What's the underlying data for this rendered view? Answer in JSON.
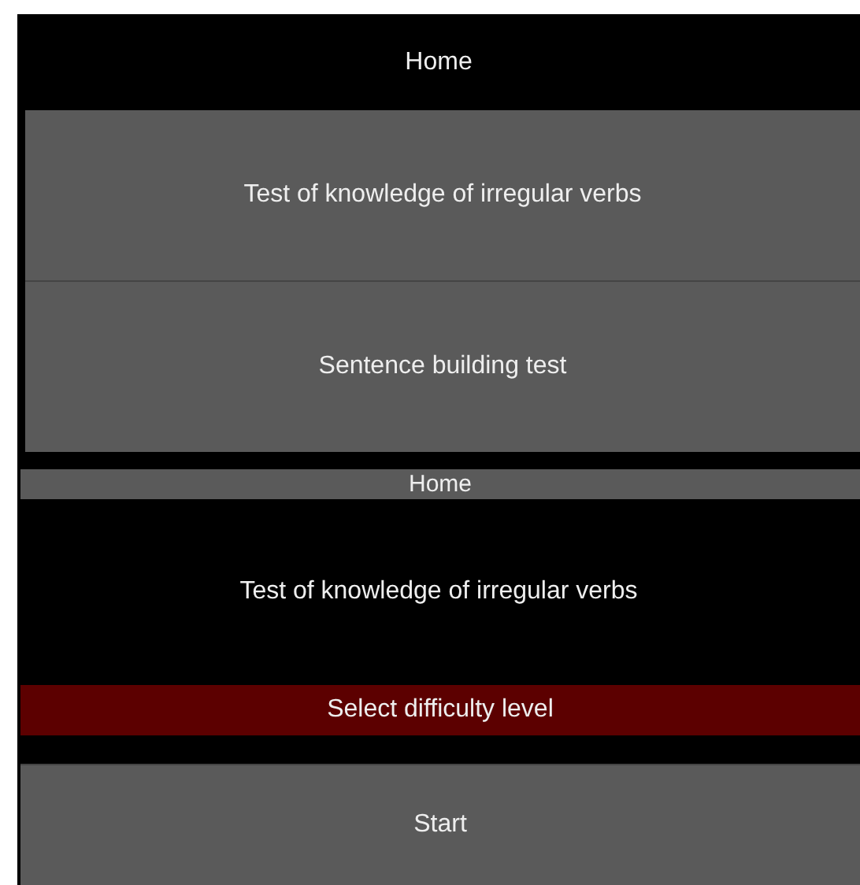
{
  "home_screen": {
    "title": "Home",
    "menu": [
      {
        "label": "Test of knowledge of irregular verbs"
      },
      {
        "label": "Sentence building test"
      }
    ]
  },
  "test_screen": {
    "title": "Home",
    "heading": "Test of knowledge of irregular verbs",
    "difficulty_button": "Select difficulty level",
    "start_button": "Start"
  }
}
